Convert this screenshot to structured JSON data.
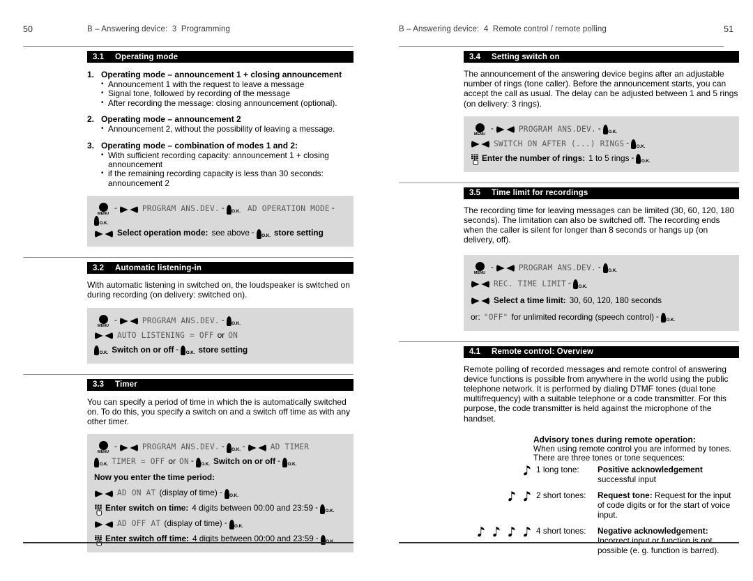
{
  "page": {
    "left": {
      "page_number": "50",
      "running_head": "B – Answering device:  3  Programming"
    },
    "right": {
      "page_number": "51",
      "running_head": "B – Answering device:  4  Remote control / remote polling"
    }
  },
  "icons": {
    "menu": "menu-key-icon",
    "menu_label": "MENU",
    "rocker": "left-right-rocker-key-icon",
    "ok": "ok-key-icon",
    "ok_label": "O.K.",
    "keypad": "keypad-finger-icon",
    "note": "music-note-icon"
  },
  "colors": {
    "section_bar_bg": "#000000",
    "section_bar_text": "#ffffff",
    "instruction_box_bg": "#d9d9d9",
    "lcd_text": "#585858",
    "rule": "#8c8c8c"
  },
  "sections": {
    "s31": {
      "number": "3.1",
      "title": "Operating mode",
      "items": [
        {
          "n": "1.",
          "heading": "Operating mode – announcement 1 + closing announcement",
          "bullets": [
            "Announcement 1 with the request to leave a message",
            "Signal tone, followed by recording of the message",
            "After recording the message: closing announcement (optional)."
          ]
        },
        {
          "n": "2.",
          "heading": "Operating mode – announcement 2",
          "bullets": [
            "Announcement 2, without the possibility of leaving a message."
          ]
        },
        {
          "n": "3.",
          "heading": "Operating mode – combination of modes 1 and 2:",
          "bullets": [
            "With sufficient recording capacity: announcement 1 + closing announcement",
            "if the remaining recording capacity is less than 30 seconds: announcement 2"
          ]
        }
      ],
      "box": {
        "l1_lcd1": "PROGRAM ANS.DEV.",
        "l1_lcd2": "AD OPERATION MODE",
        "l2_bold1": "Select operation mode:",
        "l2_norm1": "see above",
        "l2_bold2": "store setting"
      }
    },
    "s32": {
      "number": "3.2",
      "title": "Automatic listening-in",
      "text": "With automatic listening in switched on, the loudspeaker is switched on during recording (on delivery:  switched on).",
      "box": {
        "l1_lcd": "PROGRAM ANS.DEV.",
        "l2_lcd1": "AUTO LISTENING = OFF",
        "l2_or": "or",
        "l2_lcd2": "ON",
        "l3_bold1": "Switch on or off",
        "l3_bold2": "store setting"
      }
    },
    "s33": {
      "number": "3.3",
      "title": "Timer",
      "text": "You can specify a period of time in which the is automatically switched on. To do this, you specify a switch on and a switch off time as with any other timer.",
      "box": {
        "l1_lcd1": "PROGRAM ANS.DEV.",
        "l1_lcd2": "AD TIMER",
        "l2_lcd1": "TIMER = OFF",
        "l2_or": "or",
        "l2_lcd2": "ON",
        "l2_bold": "Switch on or off",
        "l3_bold": "Now you enter the time period:",
        "l4_lcd": "AD ON AT",
        "l4_norm": "(display of time)",
        "l5_bold": "Enter switch on time:",
        "l5_norm": "4 digits between 00:00 and 23:59",
        "l6_lcd": "AD OFF AT",
        "l6_norm": "(display of time)",
        "l7_bold": "Enter switch off time:",
        "l7_norm": "4 digits between 00:00 and 23:59"
      }
    },
    "s34": {
      "number": "3.4",
      "title": "Setting switch on",
      "text": "The announcement of the answering device begins after an adjustable number of rings (tone caller). Before the announcement starts, you can accept the call as usual. The delay can be adjusted between 1 and 5 rings (on delivery: 3 rings).",
      "box": {
        "l1_lcd": "PROGRAM ANS.DEV.",
        "l2_lcd": "SWITCH ON AFTER (...) RINGS",
        "l3_bold": "Enter the number of rings:",
        "l3_norm": "1 to 5 rings"
      }
    },
    "s35": {
      "number": "3.5",
      "title": "Time limit for recordings",
      "text": "The recording time for leaving messages can be limited (30, 60, 120, 180 seconds). The limitation can also be switched off. The recording ends when the caller is silent for longer than 8 seconds or hangs up (on delivery, off).",
      "box": {
        "l1_lcd": "PROGRAM ANS.DEV.",
        "l2_lcd": "REC. TIME LIMIT",
        "l3_bold": "Select a time limit:",
        "l3_norm": "30, 60, 120, 180 seconds",
        "l4_pre": "or:",
        "l4_lcd": "\"OFF\"",
        "l4_norm": "for unlimited recording (speech control)"
      }
    },
    "s41": {
      "number": "4.1",
      "title": "Remote control: Overview",
      "text": "Remote polling of recorded messages and remote control of answering device functions is possible from anywhere in the world using the public telephone network. It is performed by dialing DTMF tones (dual tone multifrequency) with a suitable telephone or a  code transmitter. For this purpose, the code transmitter is held against the microphone of the handset.",
      "advisory": {
        "heading": "Advisory tones during remote operation:",
        "intro": "When using remote control you are informed by tones. There are three tones or tone sequences:",
        "rows": [
          {
            "notes": 1,
            "count": "1 long tone:",
            "bold": "Positive acknowledgement",
            "rest": " successful input"
          },
          {
            "notes": 2,
            "count": "2 short tones:",
            "bold": "Request tone:",
            "rest": " Request for the input of code digits or for the start of voice input."
          },
          {
            "notes": 4,
            "count": "4 short tones:",
            "bold": "Negative acknowledgement:",
            "rest": " Incorrect input or function is not possible (e. g. function is barred)."
          }
        ]
      }
    }
  }
}
